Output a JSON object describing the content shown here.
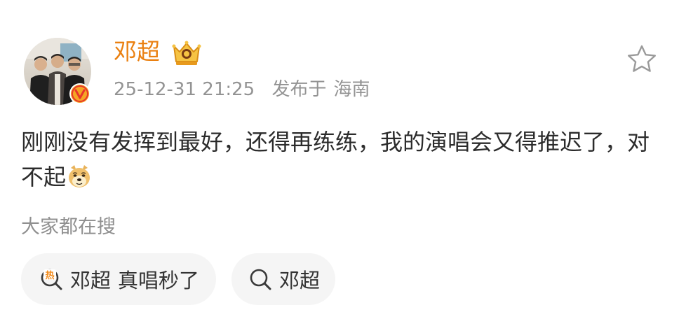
{
  "post": {
    "author": {
      "name": "邓超",
      "avatar_icon": "profile-photo",
      "verified_icon": "verified-v-badge",
      "member_icon": "crown-membership-badge"
    },
    "timestamp": "25-12-31 21:25",
    "location_prefix": "发布于",
    "location": "海南",
    "text": "刚刚没有发挥到最好，还得再练练，我的演唱会又得推迟了，对不起",
    "emoji_icon": "doge-emoji",
    "favorite_icon": "star-outline-icon"
  },
  "search": {
    "heading": "大家都在搜",
    "chips": [
      {
        "icon": "hot-search-icon",
        "parts": [
          "邓超",
          "真唱秒了"
        ]
      },
      {
        "icon": "search-icon",
        "parts": [
          "邓超"
        ]
      }
    ]
  },
  "colors": {
    "author": "#ea8011",
    "meta": "#939393",
    "body_text": "#2b2b2b",
    "chip_bg": "#f5f5f5",
    "hot_icon": "#f28a1a"
  }
}
